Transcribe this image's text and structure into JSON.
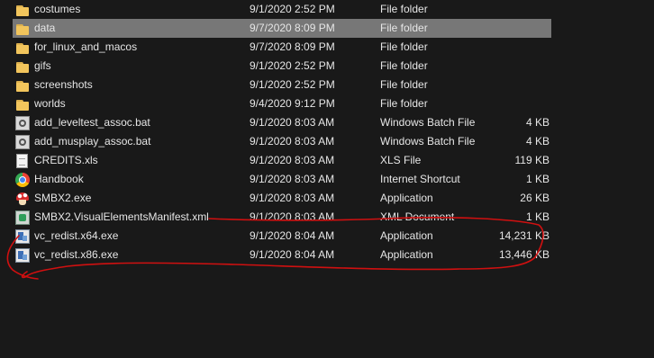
{
  "files": [
    {
      "name": "costumes",
      "date": "9/1/2020 2:52 PM",
      "type": "File folder",
      "size": "",
      "icon": "folder-icon"
    },
    {
      "name": "data",
      "date": "9/7/2020 8:09 PM",
      "type": "File folder",
      "size": "",
      "icon": "folder-icon",
      "selected": true
    },
    {
      "name": "for_linux_and_macos",
      "date": "9/7/2020 8:09 PM",
      "type": "File folder",
      "size": "",
      "icon": "folder-icon"
    },
    {
      "name": "gifs",
      "date": "9/1/2020 2:52 PM",
      "type": "File folder",
      "size": "",
      "icon": "folder-icon"
    },
    {
      "name": "screenshots",
      "date": "9/1/2020 2:52 PM",
      "type": "File folder",
      "size": "",
      "icon": "folder-icon"
    },
    {
      "name": "worlds",
      "date": "9/4/2020 9:12 PM",
      "type": "File folder",
      "size": "",
      "icon": "folder-icon"
    },
    {
      "name": "add_leveltest_assoc.bat",
      "date": "9/1/2020 8:03 AM",
      "type": "Windows Batch File",
      "size": "4 KB",
      "icon": "batch-file-icon"
    },
    {
      "name": "add_musplay_assoc.bat",
      "date": "9/1/2020 8:03 AM",
      "type": "Windows Batch File",
      "size": "4 KB",
      "icon": "batch-file-icon"
    },
    {
      "name": "CREDITS.xls",
      "date": "9/1/2020 8:03 AM",
      "type": "XLS File",
      "size": "119 KB",
      "icon": "document-icon"
    },
    {
      "name": "Handbook",
      "date": "9/1/2020 8:03 AM",
      "type": "Internet Shortcut",
      "size": "1 KB",
      "icon": "internet-shortcut-icon"
    },
    {
      "name": "SMBX2.exe",
      "date": "9/1/2020 8:03 AM",
      "type": "Application",
      "size": "26 KB",
      "icon": "mushroom-app-icon"
    },
    {
      "name": "SMBX2.VisualElementsManifest.xml",
      "date": "9/1/2020 8:03 AM",
      "type": "XML Document",
      "size": "1 KB",
      "icon": "xml-document-icon"
    },
    {
      "name": "vc_redist.x64.exe",
      "date": "9/1/2020 8:04 AM",
      "type": "Application",
      "size": "14,231 KB",
      "icon": "installer-icon"
    },
    {
      "name": "vc_redist.x86.exe",
      "date": "9/1/2020 8:04 AM",
      "type": "Application",
      "size": "13,446 KB",
      "icon": "installer-icon"
    }
  ],
  "colors": {
    "background": "#191919",
    "selected_row": "#777777",
    "text": "#e6e6e6",
    "annotation": "#d01010"
  }
}
